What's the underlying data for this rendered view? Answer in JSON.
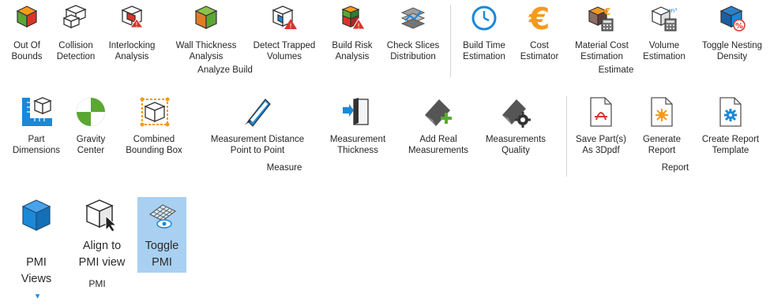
{
  "groups": {
    "analyze_build": {
      "label": "Analyze Build",
      "buttons": [
        {
          "label": "Out Of\nBounds"
        },
        {
          "label": "Collision\nDetection"
        },
        {
          "label": "Interlocking\nAnalysis"
        },
        {
          "label": "Wall Thickness\nAnalysis"
        },
        {
          "label": "Detect Trapped\nVolumes"
        },
        {
          "label": "Build Risk\nAnalysis"
        },
        {
          "label": "Check Slices\nDistribution"
        }
      ]
    },
    "estimate": {
      "label": "Estimate",
      "buttons": [
        {
          "label": "Build Time\nEstimation"
        },
        {
          "label": "Cost\nEstimator"
        },
        {
          "label": "Material Cost\nEstimation"
        },
        {
          "label": "Volume\nEstimation"
        },
        {
          "label": "Toggle Nesting\nDensity"
        }
      ]
    },
    "measure": {
      "label": "Measure",
      "buttons": [
        {
          "label": "Part\nDimensions"
        },
        {
          "label": "Gravity\nCenter"
        },
        {
          "label": "Combined\nBounding Box"
        },
        {
          "label": "Measurement Distance\nPoint to Point"
        },
        {
          "label": "Measurement\nThickness"
        },
        {
          "label": "Add Real\nMeasurements"
        },
        {
          "label": "Measurements\nQuality"
        }
      ]
    },
    "report": {
      "label": "Report",
      "buttons": [
        {
          "label": "Save Part(s)\nAs 3Dpdf"
        },
        {
          "label": "Generate\nReport"
        },
        {
          "label": "Create Report\nTemplate"
        }
      ]
    },
    "pmi": {
      "label": "PMI",
      "buttons": [
        {
          "label": "PMI\nViews",
          "dropdown_glyph": "▾"
        },
        {
          "label": "Align to\nPMI view"
        },
        {
          "label": "Toggle\nPMI"
        }
      ]
    }
  },
  "icons": {
    "out_of_bounds": "cube-out-of-bounds-icon",
    "collision": "wireframe-cubes-icon",
    "interlocking": "interlocking-cubes-icon",
    "wall_thickness": "solid-cube-icon",
    "trapped_volumes": "cube-warning-icon",
    "build_risk": "stacked-cubes-warning-icon",
    "check_slices": "slices-icon",
    "build_time": "clock-icon",
    "cost": "euro-icon",
    "material_cost": "cube-euro-calculator-icon",
    "volume": "cube-calculator-icon",
    "nesting": "cube-percent-icon",
    "part_dimensions": "ruler-cube-icon",
    "gravity": "gravity-center-icon",
    "bounding_box": "bounding-box-icon",
    "distance": "ruler-diagonal-icon",
    "thickness": "thickness-panel-icon",
    "add_real": "add-measurement-icon",
    "quality": "measurement-quality-gear-icon",
    "pdf": "pdf-document-icon",
    "gen_report": "report-document-icon",
    "create_template": "report-template-gear-icon",
    "pmi_views": "blue-cube-icon",
    "align_pmi": "cube-cursor-icon",
    "toggle_pmi": "pmi-grid-eye-icon"
  },
  "colors": {
    "accent_blue": "#1b88d8",
    "orange": "#f39a1e",
    "red_warning": "#d9342b",
    "green": "#5aa832",
    "toggle_highlight": "#a9d0f1",
    "separator": "#d4d4d4"
  }
}
